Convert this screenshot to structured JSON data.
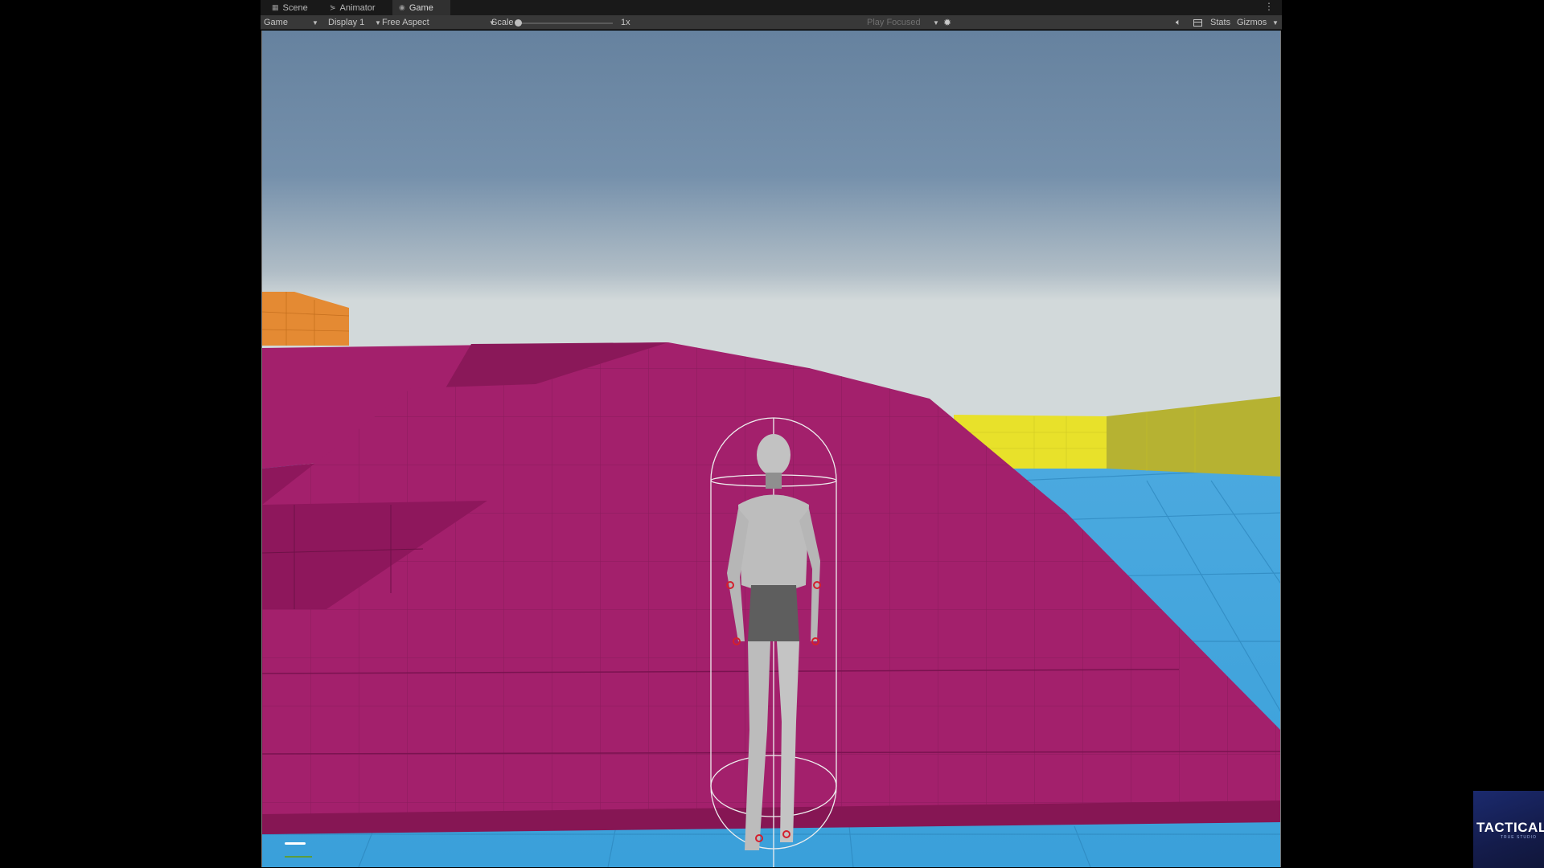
{
  "tabs": [
    {
      "label": "Scene",
      "icon": "grid-icon",
      "active": false
    },
    {
      "label": "Animator",
      "icon": "animator-icon",
      "active": false
    },
    {
      "label": "Game",
      "icon": "gamepad-icon",
      "active": true
    }
  ],
  "toolbar": {
    "view_mode": "Game",
    "display": "Display 1",
    "aspect": "Free Aspect",
    "scale_label": "Scale",
    "scale_value": "1x",
    "play_focused": "Play Focused",
    "stats": "Stats",
    "gizmos": "Gizmos"
  },
  "logo": {
    "text": "TACTICAL",
    "subtext": "TRUE STUDIO"
  },
  "colors": {
    "sky_top": "#66829f",
    "sky_bottom": "#cfd6d7",
    "platform": "#a3206c",
    "water": "#3aa4df",
    "yellow_block": "#e8e12a",
    "orange_block": "#e48a33"
  }
}
